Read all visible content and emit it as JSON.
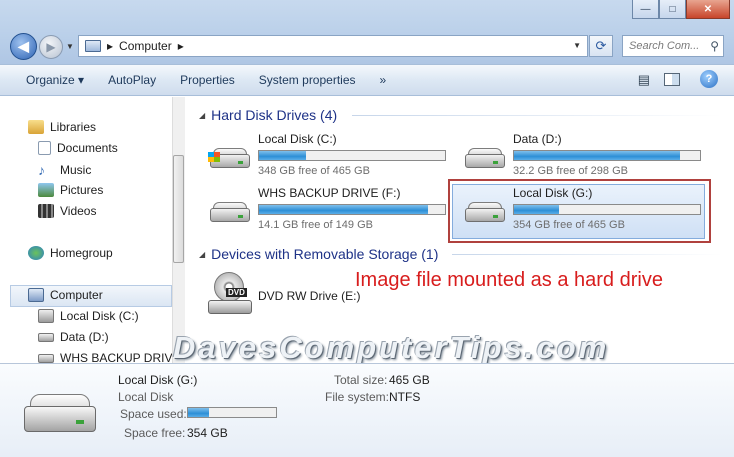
{
  "window": {
    "minimize_glyph": "—",
    "maximize_glyph": "□",
    "close_glyph": "✕"
  },
  "address": {
    "separator": "▸",
    "location": "Computer"
  },
  "search": {
    "placeholder": "Search Com..."
  },
  "toolbar": {
    "items": [
      "Organize ▾",
      "AutoPlay",
      "Properties",
      "System properties",
      "»"
    ]
  },
  "nav": {
    "libraries": "Libraries",
    "documents": "Documents",
    "music": "Music",
    "pictures": "Pictures",
    "videos": "Videos",
    "homegroup": "Homegroup",
    "computer": "Computer",
    "local_c": "Local Disk (C:)",
    "data_d": "Data (D:)",
    "whs": "WHS BACKUP DRIVE"
  },
  "content": {
    "hdd_group": "Hard Disk Drives (4)",
    "removable_group": "Devices with Removable Storage (1)",
    "drives": [
      {
        "name": "Local Disk (C:)",
        "free": "348 GB free of 465 GB",
        "used_fraction": 0.25
      },
      {
        "name": "Data (D:)",
        "free": "32.2 GB free of 298 GB",
        "used_fraction": 0.89
      },
      {
        "name": "WHS BACKUP DRIVE (F:)",
        "free": "14.1 GB free of 149 GB",
        "used_fraction": 0.91
      },
      {
        "name": "Local Disk (G:)",
        "free": "354 GB free of 465 GB",
        "used_fraction": 0.24
      }
    ],
    "dvd": {
      "name": "DVD RW Drive (E:)",
      "icon_label": "DVD"
    },
    "annotation": "Image file mounted as a hard drive",
    "watermark": "DavesComputerTips.com"
  },
  "details": {
    "name": "Local Disk (G:)",
    "type": "Local Disk",
    "space_used_label": "Space used:",
    "space_used_fraction": 0.24,
    "space_free_label": "Space free:",
    "space_free_value": "354 GB",
    "total_size_label": "Total size:",
    "total_size_value": "465 GB",
    "fs_label": "File system:",
    "fs_value": "NTFS"
  },
  "colors": {
    "accent": "#2d8fd6",
    "annotation": "#d81d1d",
    "highlight_border": "#b0413e"
  }
}
